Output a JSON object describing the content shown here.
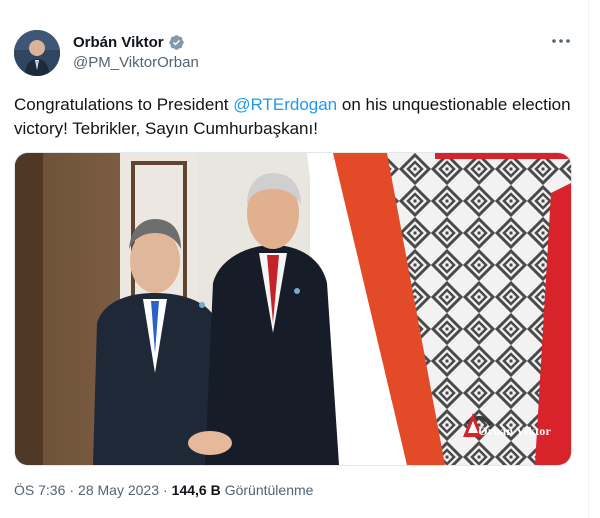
{
  "author": {
    "display_name": "Orbán Viktor",
    "handle": "@PM_ViktorOrban",
    "verified": true
  },
  "tweet": {
    "text_before": "Congratulations to President ",
    "mention": "@RTErdogan",
    "text_after": " on his unquestionable election victory! Tebrikler, Sayın Cumhurbaşkanı!"
  },
  "media": {
    "watermark": "Orbán Viktor",
    "flag_colors": [
      "#e34a27",
      "#ffffff",
      "#3f7a3b"
    ],
    "accent_red": "#d8232a"
  },
  "meta": {
    "time": "ÖS 7:36",
    "separator": "·",
    "date": "28 May 2023",
    "views_count": "144,6 B",
    "views_label": "Görüntülenme"
  },
  "icons": [
    "verified-badge-icon",
    "more-options-icon"
  ]
}
